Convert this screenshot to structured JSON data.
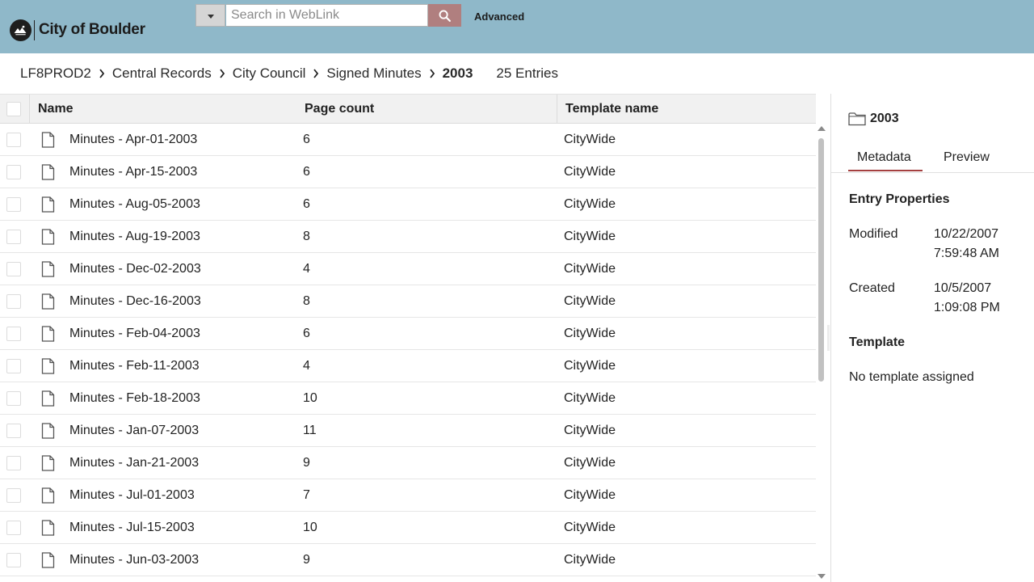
{
  "header": {
    "logo_text": "City of Boulder",
    "search_placeholder": "Search in WebLink",
    "advanced_label": "Advanced",
    "colors": {
      "header_bg": "#8fb8c9",
      "search_button": "#b07f7f"
    }
  },
  "breadcrumb": {
    "items": [
      "LF8PROD2",
      "Central Records",
      "City Council",
      "Signed Minutes"
    ],
    "current": "2003",
    "entries": "25 Entries"
  },
  "table": {
    "columns": {
      "name": "Name",
      "page_count": "Page count",
      "template_name": "Template name"
    },
    "rows": [
      {
        "name": "Minutes - Apr-01-2003",
        "page_count": "6",
        "template": "CityWide"
      },
      {
        "name": "Minutes - Apr-15-2003",
        "page_count": "6",
        "template": "CityWide"
      },
      {
        "name": "Minutes - Aug-05-2003",
        "page_count": "6",
        "template": "CityWide"
      },
      {
        "name": "Minutes - Aug-19-2003",
        "page_count": "8",
        "template": "CityWide"
      },
      {
        "name": "Minutes - Dec-02-2003",
        "page_count": "4",
        "template": "CityWide"
      },
      {
        "name": "Minutes - Dec-16-2003",
        "page_count": "8",
        "template": "CityWide"
      },
      {
        "name": "Minutes - Feb-04-2003",
        "page_count": "6",
        "template": "CityWide"
      },
      {
        "name": "Minutes - Feb-11-2003",
        "page_count": "4",
        "template": "CityWide"
      },
      {
        "name": "Minutes - Feb-18-2003",
        "page_count": "10",
        "template": "CityWide"
      },
      {
        "name": "Minutes - Jan-07-2003",
        "page_count": "11",
        "template": "CityWide"
      },
      {
        "name": "Minutes - Jan-21-2003",
        "page_count": "9",
        "template": "CityWide"
      },
      {
        "name": "Minutes - Jul-01-2003",
        "page_count": "7",
        "template": "CityWide"
      },
      {
        "name": "Minutes - Jul-15-2003",
        "page_count": "10",
        "template": "CityWide"
      },
      {
        "name": "Minutes - Jun-03-2003",
        "page_count": "9",
        "template": "CityWide"
      }
    ]
  },
  "panel": {
    "title": "2003",
    "tabs": [
      "Metadata",
      "Preview"
    ],
    "active_tab": "Metadata",
    "entry_properties_title": "Entry Properties",
    "modified_label": "Modified",
    "modified_date": "10/22/2007",
    "modified_time": "7:59:48 AM",
    "created_label": "Created",
    "created_date": "10/5/2007",
    "created_time": "1:09:08 PM",
    "template_title": "Template",
    "template_value": "No template assigned",
    "accent_color": "#a44040"
  }
}
